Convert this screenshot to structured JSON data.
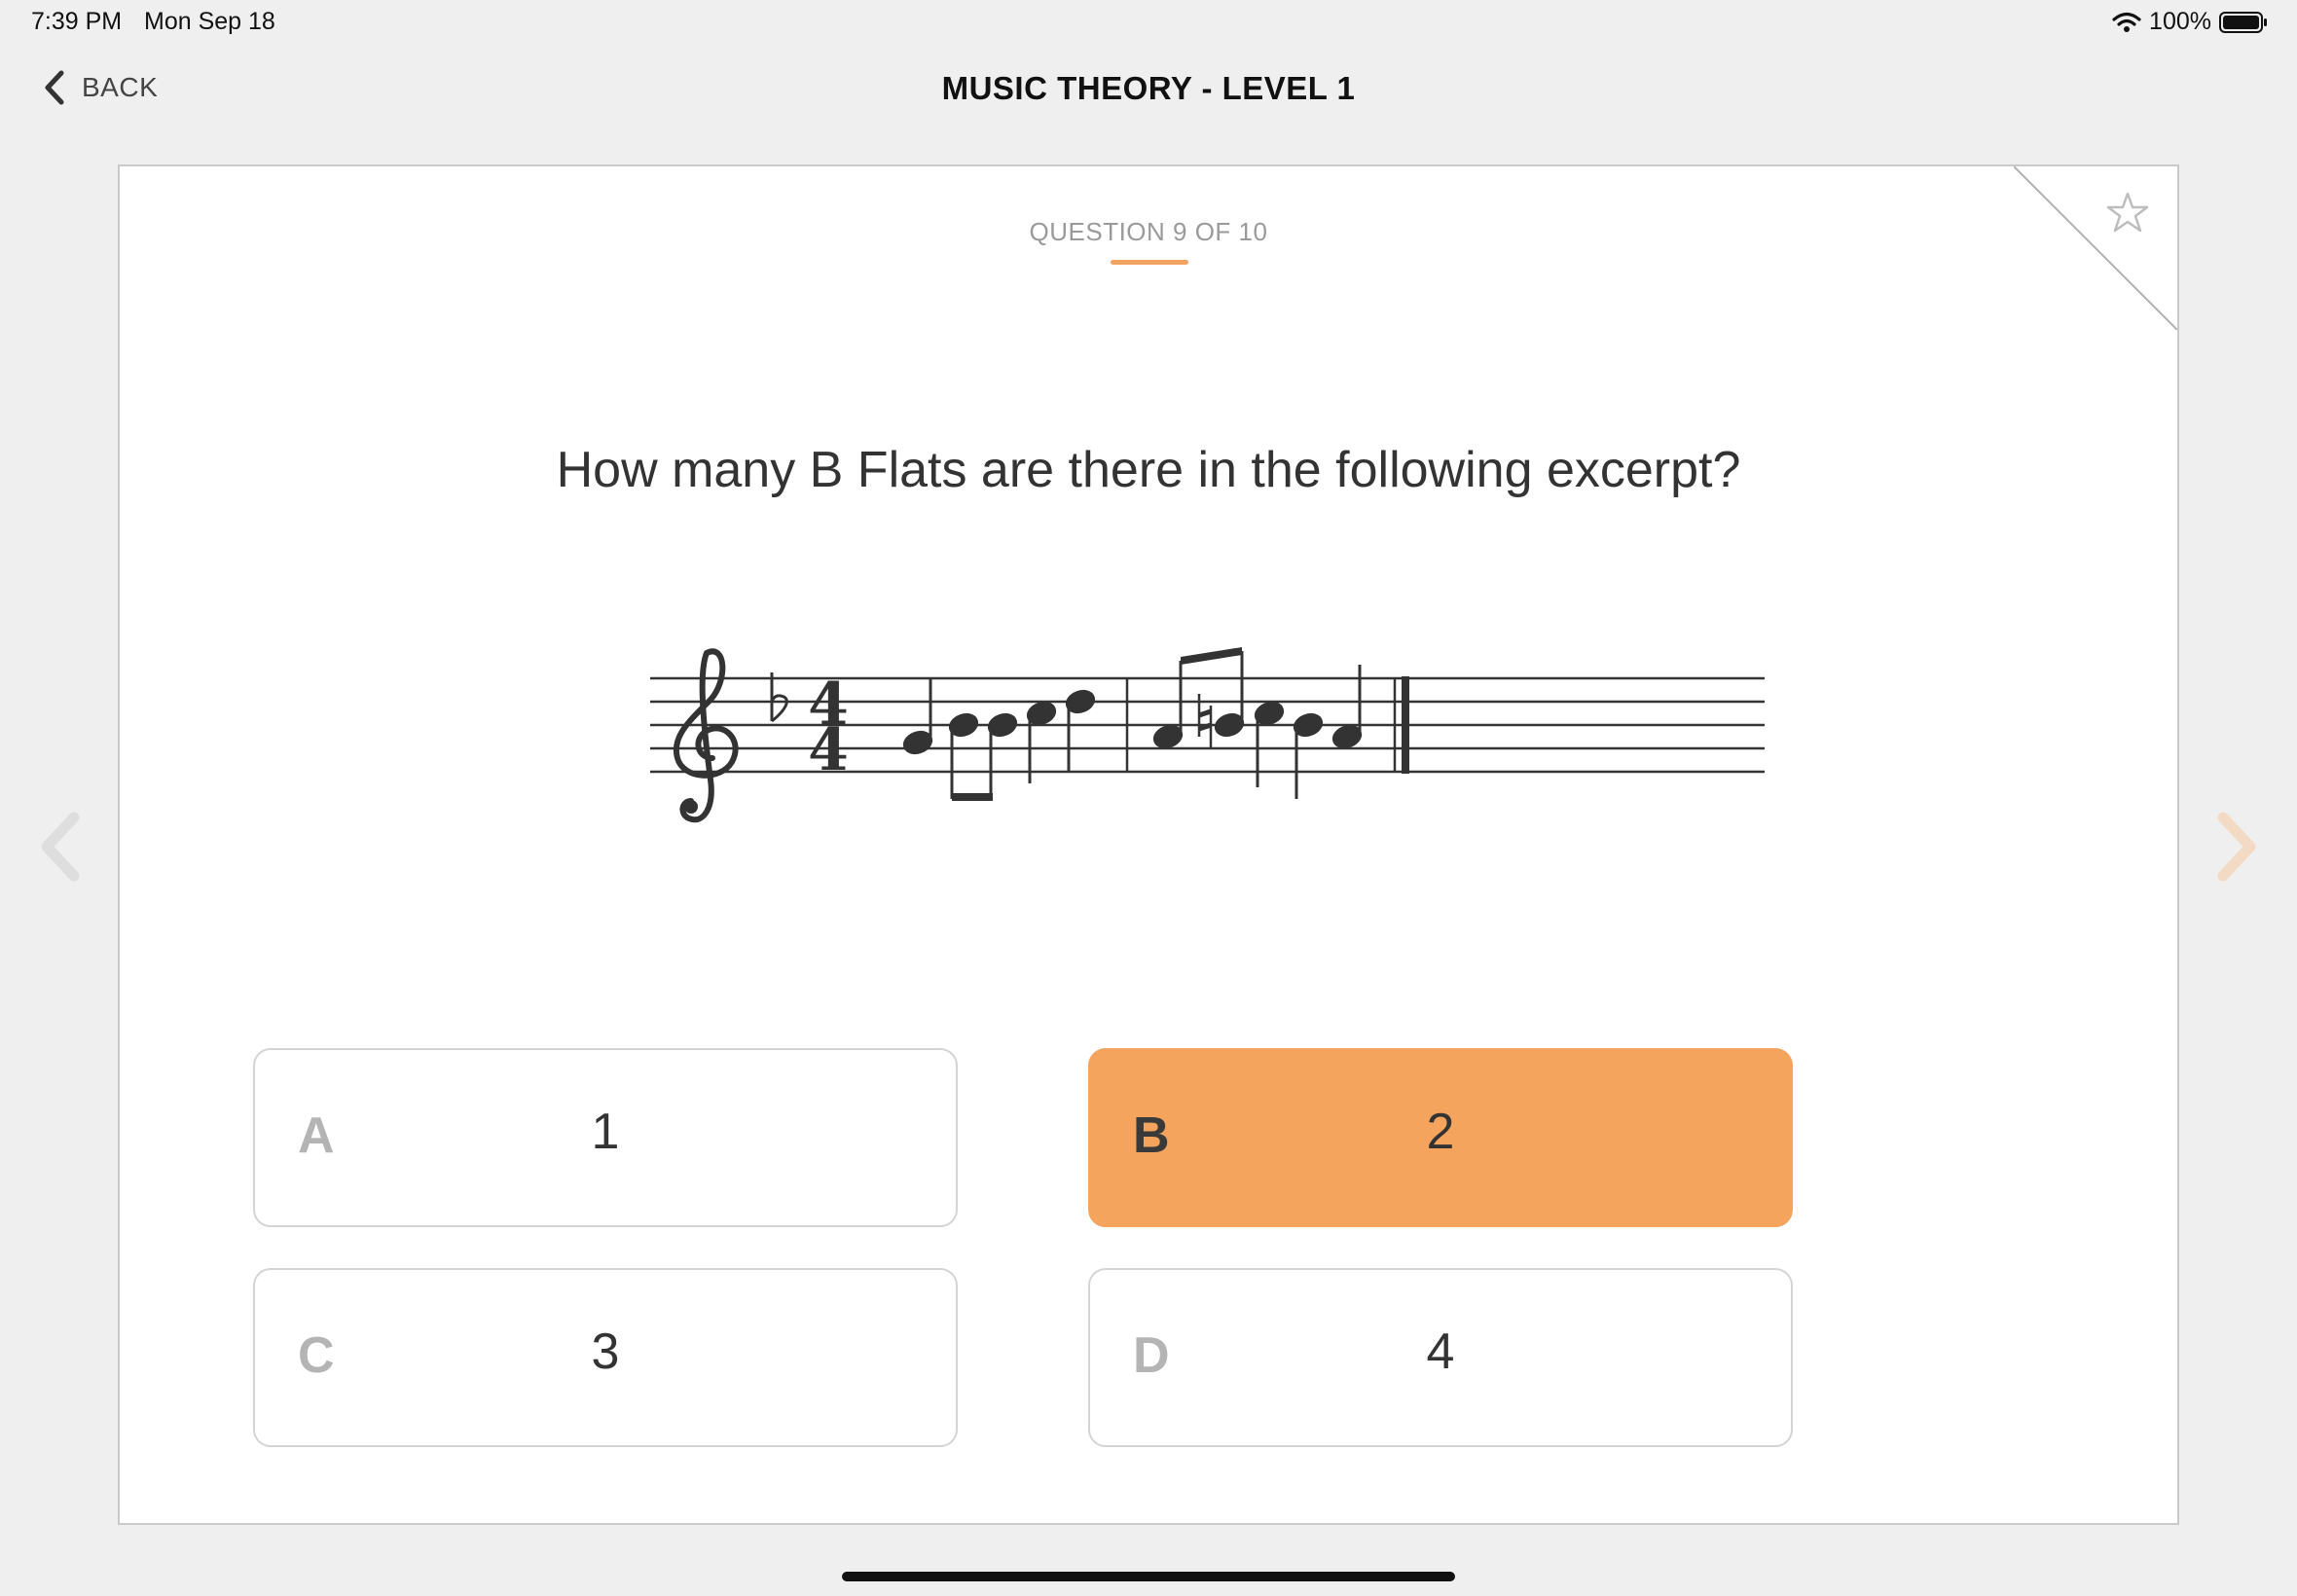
{
  "status_bar": {
    "time": "7:39 PM",
    "date": "Mon Sep 18",
    "battery": "100%"
  },
  "nav": {
    "back_label": "BACK",
    "title": "MUSIC THEORY - LEVEL 1"
  },
  "quiz": {
    "counter": "QUESTION 9 OF 10",
    "question": "How many B Flats are there in the following excerpt?",
    "options": [
      {
        "letter": "A",
        "value": "1"
      },
      {
        "letter": "B",
        "value": "2",
        "selected": true
      },
      {
        "letter": "C",
        "value": "3"
      },
      {
        "letter": "D",
        "value": "4"
      }
    ],
    "time_signature": {
      "top": "4",
      "bottom": "4"
    }
  },
  "colors": {
    "accent": "#f4a45d",
    "background": "#efefef",
    "card": "#ffffff"
  },
  "icons": [
    "back-chevron-icon",
    "wifi-icon",
    "battery-icon",
    "star-icon",
    "previous-arrow-icon",
    "next-arrow-icon"
  ]
}
